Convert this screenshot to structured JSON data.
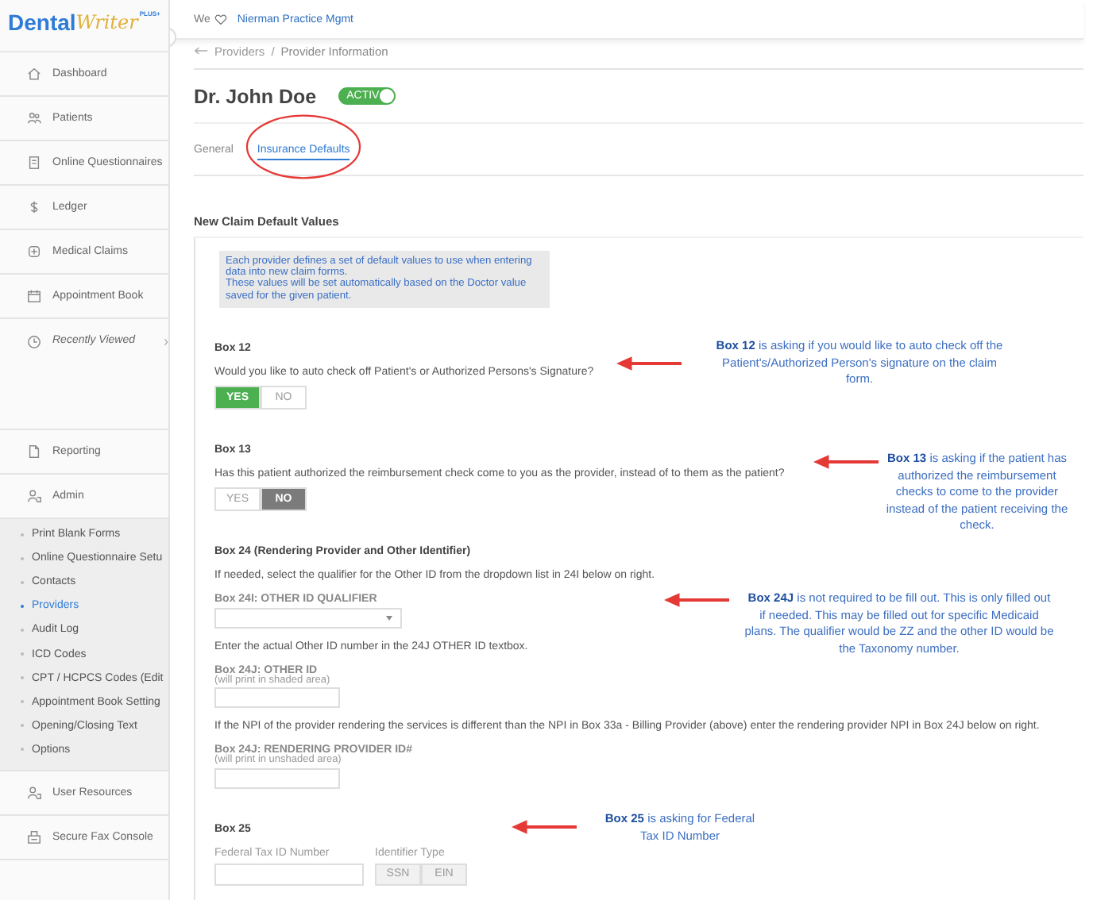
{
  "logo": {
    "brand": "Dental",
    "script": "Writer",
    "badge": "PLUS+"
  },
  "sidebar": {
    "items": [
      {
        "label": "Dashboard",
        "kind": "nav"
      },
      {
        "label": "Patients",
        "kind": "nav"
      },
      {
        "label": "Online Questionnaires",
        "kind": "nav"
      },
      {
        "label": "Ledger",
        "kind": "nav"
      },
      {
        "label": "Medical Claims",
        "kind": "nav"
      },
      {
        "label": "Appointment Book",
        "kind": "nav"
      },
      {
        "label": "Recently Viewed",
        "kind": "recent"
      },
      {
        "label": "Reporting",
        "kind": "nav"
      },
      {
        "label": "Admin",
        "kind": "nav",
        "children": [
          {
            "label": "Print Blank Forms",
            "selected": false
          },
          {
            "label": "Online Questionnaire Setu",
            "selected": false
          },
          {
            "label": "Contacts",
            "selected": false
          },
          {
            "label": "Providers",
            "selected": true
          },
          {
            "label": "Audit Log",
            "selected": false
          },
          {
            "label": "ICD Codes",
            "selected": false
          },
          {
            "label": "CPT / HCPCS Codes (Edit",
            "selected": false
          },
          {
            "label": "Appointment Book Setting",
            "selected": false
          },
          {
            "label": "Opening/Closing Text",
            "selected": false
          },
          {
            "label": "Options",
            "selected": false
          }
        ]
      },
      {
        "label": "User Resources",
        "kind": "nav"
      },
      {
        "label": "Secure Fax Console",
        "kind": "nav"
      }
    ]
  },
  "top_bar": {
    "greeting": "We",
    "practice": "Nierman Practice Mgmt"
  },
  "breadcrumb": {
    "items": [
      "Providers",
      "Provider Information"
    ],
    "separator": "/"
  },
  "provider": {
    "name": "Dr. John Doe",
    "status": {
      "label": "ACTIV",
      "on": true
    }
  },
  "tabs": [
    {
      "label": "General",
      "selected": false
    },
    {
      "label": "Insurance Defaults",
      "selected": true
    }
  ],
  "section_title": "New Claim Default Values",
  "info": [
    "Each provider defines a set of default values to use when entering data into new claim forms.",
    "These values will be set automatically based on the Doctor value saved for the given patient."
  ],
  "form": [
    {
      "kind": "heading",
      "text": "Box 12"
    },
    {
      "kind": "text",
      "text": "Would you like to auto check off Patient's or Authorized Persons's Signature?"
    },
    {
      "kind": "toggle",
      "options": [
        {
          "label": "YES",
          "selected": true,
          "color": "#4caf50"
        },
        {
          "label": "NO",
          "selected": false
        }
      ]
    },
    {
      "kind": "heading",
      "text": "Box 13"
    },
    {
      "kind": "text",
      "text": "Has this patient authorized the reimbursement check come to you as the provider, instead of to them as the patient?"
    },
    {
      "kind": "toggle",
      "options": [
        {
          "label": "YES",
          "selected": false
        },
        {
          "label": "NO",
          "selected": true,
          "color": "#7b7b7b"
        }
      ]
    },
    {
      "kind": "heading",
      "text": "Box 24 (Rendering Provider and Other Identifier)"
    },
    {
      "kind": "text",
      "text": "If needed, select the qualifier for the Other ID from the dropdown list in 24I below on right."
    },
    {
      "kind": "select",
      "label": "Box 24I: OTHER ID QUALIFIER"
    },
    {
      "kind": "text",
      "text": "Enter the actual Other ID number in the 24J OTHER ID textbox."
    },
    {
      "kind": "input",
      "label": "Box 24J: OTHER ID",
      "hint": "(will print in shaded area)"
    },
    {
      "kind": "text",
      "text": "If the NPI of the provider rendering the services is different than the NPI in Box 33a - Billing Provider (above) enter the rendering provider NPI in Box 24J below on right."
    },
    {
      "kind": "input",
      "label": "Box 24J: RENDERING PROVIDER ID#",
      "hint": "(will print in unshaded area)"
    },
    {
      "kind": "heading",
      "text": "Box 25"
    },
    {
      "kind": "tax",
      "field_label": "Federal Tax ID Number",
      "type_label": "Identifier Type",
      "options": [
        {
          "label": "SSN",
          "selected": false
        },
        {
          "label": "EIN",
          "selected": false
        }
      ]
    }
  ],
  "notes": [
    {
      "text": "**Box 12** is asking if you would like to auto check off the Patient's/Authorized Person's signature on the claim form."
    },
    {
      "text": "**Box 13** is asking if the patient has authorized the reimbursement checks to come to the provider instead of the patient receiving the check."
    },
    {
      "text": "**Box 24J** is not required to be fill out. This is only filled out if needed. This may be filled out for specific Medicaid plans. The qualifier would be ZZ and the other ID would be the Taxonomy number."
    },
    {
      "text": "**Box 25** is asking for Federal Tax ID Number"
    }
  ]
}
